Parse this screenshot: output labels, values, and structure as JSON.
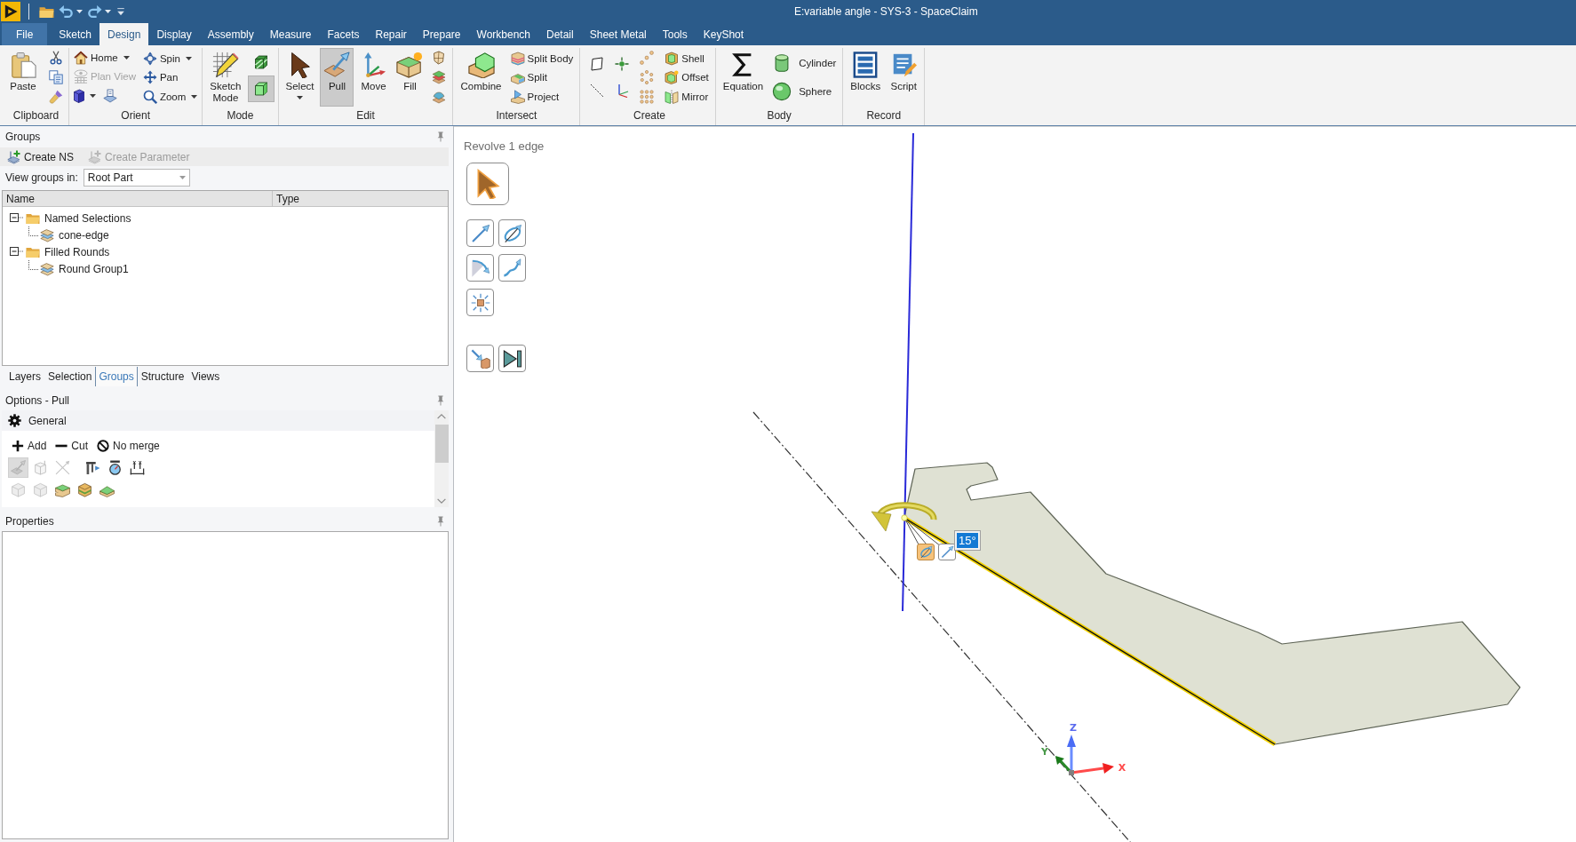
{
  "window": {
    "title": "E:variable angle - SYS-3 - SpaceClaim"
  },
  "ribbon_tabs": [
    {
      "label": "File",
      "kind": "file",
      "selected": false
    },
    {
      "label": "Sketch",
      "kind": "tab",
      "selected": false
    },
    {
      "label": "Design",
      "kind": "tab",
      "selected": true
    },
    {
      "label": "Display",
      "kind": "tab",
      "selected": false
    },
    {
      "label": "Assembly",
      "kind": "tab",
      "selected": false
    },
    {
      "label": "Measure",
      "kind": "tab",
      "selected": false
    },
    {
      "label": "Facets",
      "kind": "tab",
      "selected": false
    },
    {
      "label": "Repair",
      "kind": "tab",
      "selected": false
    },
    {
      "label": "Prepare",
      "kind": "tab",
      "selected": false
    },
    {
      "label": "Workbench",
      "kind": "tab",
      "selected": false
    },
    {
      "label": "Detail",
      "kind": "tab",
      "selected": false
    },
    {
      "label": "Sheet Metal",
      "kind": "tab",
      "selected": false
    },
    {
      "label": "Tools",
      "kind": "tab",
      "selected": false
    },
    {
      "label": "KeyShot",
      "kind": "tab",
      "selected": false
    }
  ],
  "ribbon_groups": [
    {
      "label": "Clipboard",
      "columns": [
        [
          {
            "kind": "large",
            "label": "Paste"
          }
        ],
        [
          {
            "kind": "icon"
          },
          {
            "kind": "icon"
          },
          {
            "kind": "icon"
          }
        ]
      ]
    },
    {
      "label": "Orient",
      "columns": [
        [
          {
            "kind": "small",
            "label": "Home",
            "dropdown": true,
            "disabled": false
          },
          {
            "kind": "small",
            "label": "Plan View",
            "dropdown": false,
            "disabled": true
          },
          {
            "kind": "row",
            "items": [
              {
                "kind": "icon",
                "dropdown": true
              },
              {
                "kind": "icon",
                "dropdown": false
              }
            ]
          }
        ],
        [
          {
            "kind": "small",
            "label": "Spin",
            "dropdown": true,
            "disabled": false
          },
          {
            "kind": "small",
            "label": "Pan",
            "dropdown": false,
            "disabled": false
          },
          {
            "kind": "small",
            "label": "Zoom",
            "dropdown": true,
            "disabled": false
          }
        ]
      ]
    },
    {
      "label": "Mode",
      "columns": [
        [
          {
            "kind": "large",
            "label": "Sketch Mode",
            "selected": false
          }
        ],
        [
          {
            "kind": "icon",
            "selected": false
          },
          {
            "kind": "icon",
            "selected": true
          }
        ]
      ]
    },
    {
      "label": "Edit",
      "columns": [
        [
          {
            "kind": "large",
            "label": "Select",
            "dropdown": true,
            "selected": false
          }
        ],
        [
          {
            "kind": "large",
            "label": "Pull",
            "dropdown": false,
            "selected": true
          }
        ],
        [
          {
            "kind": "large",
            "label": "Move",
            "dropdown": false,
            "selected": false
          }
        ],
        [
          {
            "kind": "large",
            "label": "Fill",
            "dropdown": false,
            "selected": false
          }
        ],
        [
          {
            "kind": "icon"
          },
          {
            "kind": "icon"
          },
          {
            "kind": "icon"
          }
        ]
      ]
    },
    {
      "label": "Intersect",
      "columns": [
        [
          {
            "kind": "large",
            "label": "Combine"
          }
        ],
        [
          {
            "kind": "small",
            "label": "Split Body"
          },
          {
            "kind": "small",
            "label": "Split"
          },
          {
            "kind": "small",
            "label": "Project"
          }
        ]
      ]
    },
    {
      "label": "Create",
      "columns": [
        [
          {
            "kind": "icon"
          },
          {
            "kind": "icon"
          }
        ],
        [
          {
            "kind": "icon"
          },
          {
            "kind": "icon"
          }
        ],
        [
          {
            "kind": "icon"
          },
          {
            "kind": "icon"
          },
          {
            "kind": "icon"
          }
        ],
        [
          {
            "kind": "small",
            "label": "Shell"
          },
          {
            "kind": "small",
            "label": "Offset"
          },
          {
            "kind": "small",
            "label": "Mirror"
          }
        ]
      ]
    },
    {
      "label": "Body",
      "columns": [
        [
          {
            "kind": "large",
            "label": "Equation"
          }
        ],
        [
          {
            "kind": "medium",
            "label": "Cylinder"
          },
          {
            "kind": "medium",
            "label": "Sphere"
          }
        ]
      ]
    },
    {
      "label": "Record",
      "columns": [
        [
          {
            "kind": "large",
            "label": "Blocks"
          }
        ],
        [
          {
            "kind": "large",
            "label": "Script"
          }
        ]
      ]
    }
  ],
  "groups_panel": {
    "title": "Groups",
    "actions": [
      {
        "label": "Create NS",
        "disabled": false
      },
      {
        "label": "Create Parameter",
        "disabled": true
      }
    ],
    "view_groups_in": {
      "label": "View groups in:",
      "value": "Root Part"
    },
    "columns": [
      "Name",
      "Type"
    ],
    "tree": [
      {
        "label": "Named Selections",
        "expanded": true,
        "children": [
          {
            "label": "cone-edge"
          }
        ]
      },
      {
        "label": "Filled Rounds",
        "expanded": true,
        "children": [
          {
            "label": "Round Group1"
          }
        ]
      }
    ]
  },
  "panel_tabs": [
    {
      "label": "Layers",
      "selected": false
    },
    {
      "label": "Selection",
      "selected": false
    },
    {
      "label": "Groups",
      "selected": true
    },
    {
      "label": "Structure",
      "selected": false
    },
    {
      "label": "Views",
      "selected": false
    }
  ],
  "options_panel": {
    "title": "Options - Pull",
    "section": "General",
    "merge_modes": [
      {
        "label": "Add"
      },
      {
        "label": "Cut"
      },
      {
        "label": "No merge"
      }
    ],
    "toggle_rows": [
      [
        {
          "selected": true,
          "disabled": true
        },
        {
          "selected": false,
          "disabled": true
        },
        {
          "selected": false,
          "disabled": true
        },
        {
          "selected": false,
          "disabled": false
        },
        {
          "selected": false,
          "disabled": false
        },
        {
          "selected": false,
          "disabled": false
        }
      ],
      [
        {
          "selected": false,
          "disabled": true
        },
        {
          "selected": false,
          "disabled": true
        },
        {
          "selected": false,
          "disabled": false
        },
        {
          "selected": false,
          "disabled": false
        },
        {
          "selected": false,
          "disabled": false
        }
      ]
    ]
  },
  "properties_panel": {
    "title": "Properties"
  },
  "viewport": {
    "hint": "Revolve 1 edge",
    "handles": [
      {
        "selected": true
      },
      {
        "selected": false
      }
    ],
    "angle": "15°",
    "axis_labels": {
      "x": "X",
      "y": "Y",
      "z": "Z"
    }
  }
}
